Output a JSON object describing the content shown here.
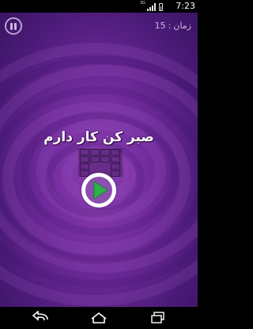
{
  "status_bar": {
    "network_type": "3G",
    "time": "7:23",
    "icons": [
      "signal-icon",
      "battery-icon"
    ]
  },
  "game": {
    "timer_label": "زمان",
    "timer_separator": ":",
    "timer_value": "15",
    "phrase": "صبر کن کار دارم",
    "colors": {
      "background": "#6e2a9a",
      "play_triangle": "#2bb34a",
      "play_ring": "#ffffff"
    }
  },
  "nav_bar": {
    "icons": [
      "back-icon",
      "home-icon",
      "recent-apps-icon"
    ]
  }
}
